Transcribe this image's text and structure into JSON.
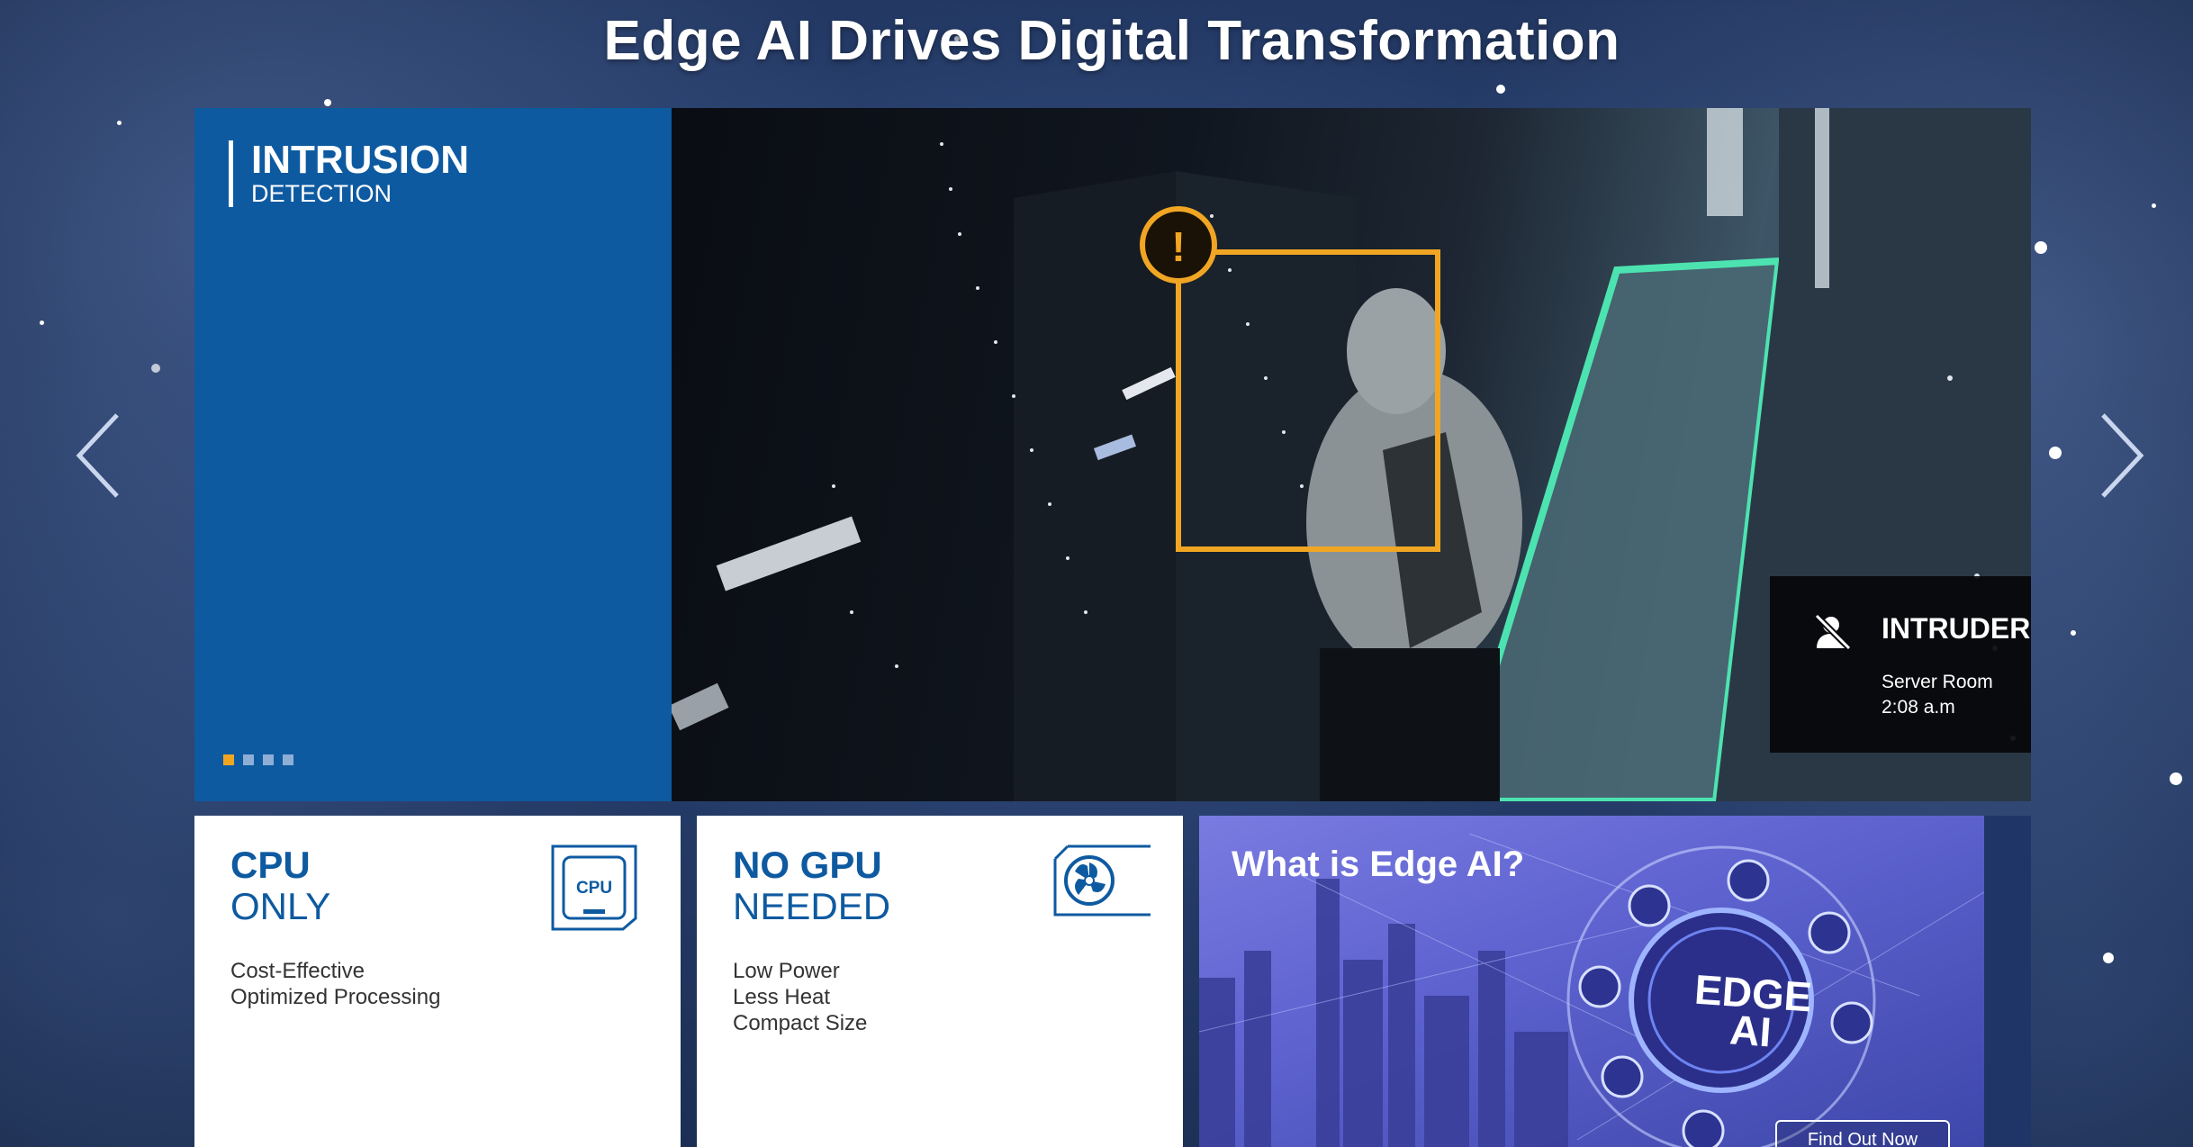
{
  "page": {
    "title": "Edge AI Drives Digital Transformation"
  },
  "carousel": {
    "slide": {
      "title": "INTRUSION",
      "subtitle": "DETECTION"
    },
    "dots_total": 4,
    "active_dot": 1,
    "alert": {
      "title": "INTRUDER",
      "location": "Server Room",
      "time": "2:08 a.m"
    },
    "prev_icon": "chevron-left-icon",
    "next_icon": "chevron-right-icon"
  },
  "cards": [
    {
      "title_line1": "CPU",
      "title_line2": "ONLY",
      "text": [
        "Cost-Effective",
        "Optimized Processing"
      ],
      "icon": "cpu-chip-icon",
      "icon_label": "CPU"
    },
    {
      "title_line1": "NO GPU",
      "title_line2": "NEEDED",
      "text": [
        "Low Power",
        "Less Heat",
        "Compact Size"
      ],
      "icon": "gpu-fan-icon"
    }
  ],
  "promo": {
    "title": "What is Edge AI?",
    "badge_line1": "EDGE",
    "badge_line2": "AI",
    "button_label": "Find Out Now"
  },
  "colors": {
    "brand_blue": "#0e5aa1",
    "accent_orange": "#f0a623",
    "detection_green": "#4de3b0"
  }
}
